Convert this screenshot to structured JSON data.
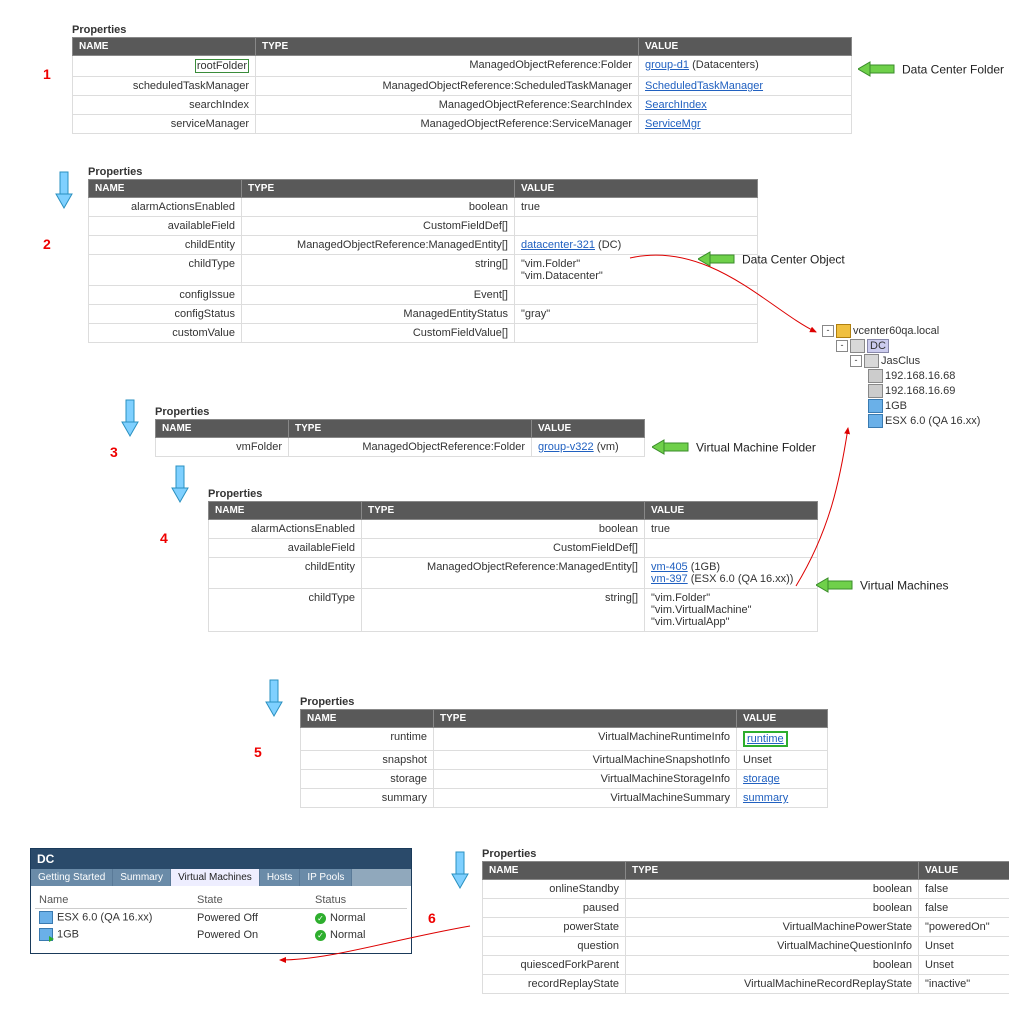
{
  "headers": {
    "name": "NAME",
    "type": "TYPE",
    "value": "VALUE",
    "properties": "Properties"
  },
  "steps": {
    "1": "1",
    "2": "2",
    "3": "3",
    "4": "4",
    "5": "5",
    "6": "6"
  },
  "callouts": {
    "dcFolder": "Data Center Folder",
    "dcObject": "Data Center Object",
    "vmFolder": "Virtual Machine Folder",
    "vms": "Virtual Machines"
  },
  "table1": {
    "rows": [
      {
        "name": "rootFolder",
        "type": "ManagedObjectReference:Folder",
        "link": "group-d1",
        "suffix": " (Datacenters)",
        "nameBoxed": true
      },
      {
        "name": "scheduledTaskManager",
        "type": "ManagedObjectReference:ScheduledTaskManager",
        "link": "ScheduledTaskManager"
      },
      {
        "name": "searchIndex",
        "type": "ManagedObjectReference:SearchIndex",
        "link": "SearchIndex"
      },
      {
        "name": "serviceManager",
        "type": "ManagedObjectReference:ServiceManager",
        "link": "ServiceMgr"
      }
    ]
  },
  "table2": {
    "rows": [
      {
        "name": "alarmActionsEnabled",
        "type": "boolean",
        "value": "true"
      },
      {
        "name": "availableField",
        "type": "CustomFieldDef[]",
        "value": ""
      },
      {
        "name": "childEntity",
        "type": "ManagedObjectReference:ManagedEntity[]",
        "link": "datacenter-321",
        "suffix": " (DC)"
      },
      {
        "name": "childType",
        "type": "string[]",
        "value": "\"vim.Folder\"\n\"vim.Datacenter\""
      },
      {
        "name": "configIssue",
        "type": "Event[]",
        "value": ""
      },
      {
        "name": "configStatus",
        "type": "ManagedEntityStatus",
        "value": "\"gray\""
      },
      {
        "name": "customValue",
        "type": "CustomFieldValue[]",
        "value": ""
      }
    ]
  },
  "table3": {
    "rows": [
      {
        "name": "vmFolder",
        "type": "ManagedObjectReference:Folder",
        "link": "group-v322",
        "suffix": " (vm)"
      }
    ]
  },
  "table4": {
    "rows": [
      {
        "name": "alarmActionsEnabled",
        "type": "boolean",
        "value": "true"
      },
      {
        "name": "availableField",
        "type": "CustomFieldDef[]",
        "value": ""
      },
      {
        "name": "childEntity",
        "type": "ManagedObjectReference:ManagedEntity[]",
        "links": [
          {
            "link": "vm-405",
            "suffix": " (1GB)"
          },
          {
            "link": "vm-397",
            "suffix": " (ESX 6.0 (QA 16.xx))"
          }
        ]
      },
      {
        "name": "childType",
        "type": "string[]",
        "value": "\"vim.Folder\"\n\"vim.VirtualMachine\"\n\"vim.VirtualApp\""
      }
    ]
  },
  "table5": {
    "rows": [
      {
        "name": "runtime",
        "type": "VirtualMachineRuntimeInfo",
        "link": "runtime",
        "boxed": true
      },
      {
        "name": "snapshot",
        "type": "VirtualMachineSnapshotInfo",
        "value": "Unset"
      },
      {
        "name": "storage",
        "type": "VirtualMachineStorageInfo",
        "link": "storage"
      },
      {
        "name": "summary",
        "type": "VirtualMachineSummary",
        "link": "summary"
      }
    ]
  },
  "table6": {
    "rows": [
      {
        "name": "onlineStandby",
        "type": "boolean",
        "value": "false"
      },
      {
        "name": "paused",
        "type": "boolean",
        "value": "false"
      },
      {
        "name": "powerState",
        "type": "VirtualMachinePowerState",
        "value": "\"poweredOn\"",
        "hl": true
      },
      {
        "name": "question",
        "type": "VirtualMachineQuestionInfo",
        "value": "Unset"
      },
      {
        "name": "quiescedForkParent",
        "type": "boolean",
        "value": "Unset"
      },
      {
        "name": "recordReplayState",
        "type": "VirtualMachineRecordReplayState",
        "value": "\"inactive\""
      }
    ]
  },
  "tree": {
    "root": "vcenter60qa.local",
    "dc": "DC",
    "cluster": "JasClus",
    "host1": "192.168.16.68",
    "host2": "192.168.16.69",
    "vm1": "1GB",
    "vm2": "ESX 6.0 (QA 16.xx)"
  },
  "dcpanel": {
    "title": "DC",
    "tabs": [
      "Getting Started",
      "Summary",
      "Virtual Machines",
      "Hosts",
      "IP Pools"
    ],
    "cols": {
      "name": "Name",
      "state": "State",
      "status": "Status"
    },
    "rows": [
      {
        "name": "ESX 6.0 (QA 16.xx)",
        "state": "Powered Off",
        "status": "Normal"
      },
      {
        "name": "1GB",
        "state": "Powered On",
        "status": "Normal"
      }
    ]
  }
}
